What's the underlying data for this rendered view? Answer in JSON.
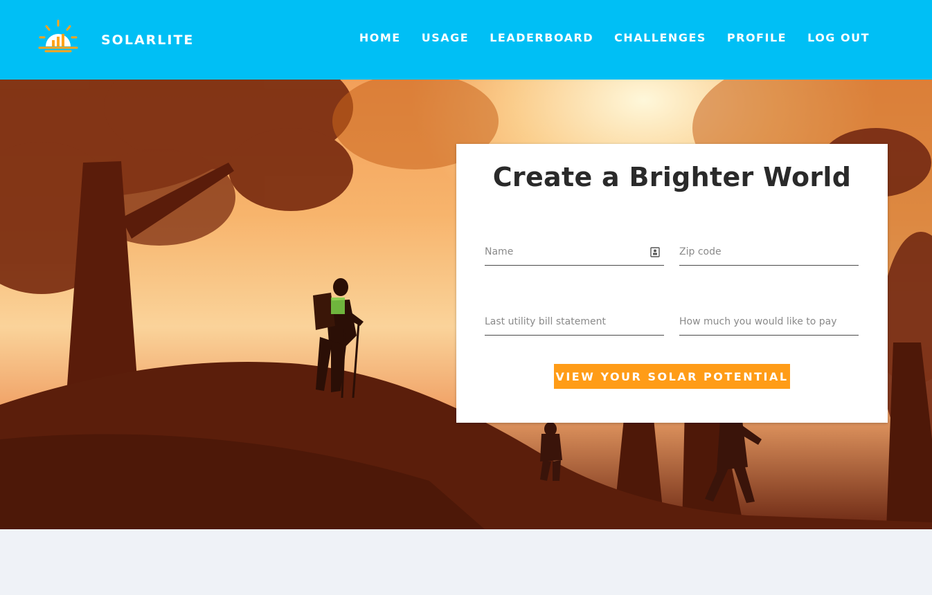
{
  "brand": {
    "name": "SOLARLITE",
    "logo_icon": "sun-bar-chart-icon"
  },
  "nav": {
    "items": [
      {
        "label": "HOME"
      },
      {
        "label": "USAGE"
      },
      {
        "label": "LEADERBOARD"
      },
      {
        "label": "CHALLENGES"
      },
      {
        "label": "PROFILE"
      },
      {
        "label": "LOG OUT"
      }
    ]
  },
  "hero": {
    "image": "hiker-silhouette-forest-sunset"
  },
  "form": {
    "title": "Create a Brighter World",
    "fields": {
      "name": {
        "placeholder": "Name",
        "value": "",
        "icon": "contact-card-icon"
      },
      "zip": {
        "placeholder": "Zip code",
        "value": ""
      },
      "bill": {
        "placeholder": "Last utility bill statement",
        "value": ""
      },
      "pay": {
        "placeholder": "How much you would like to pay",
        "value": ""
      }
    },
    "submit_label": "VIEW YOUR SOLAR POTENTIAL"
  },
  "colors": {
    "header_bg": "#00bff5",
    "accent": "#ff9c17",
    "page_bg": "#eff2f7",
    "card_bg": "#ffffff"
  }
}
